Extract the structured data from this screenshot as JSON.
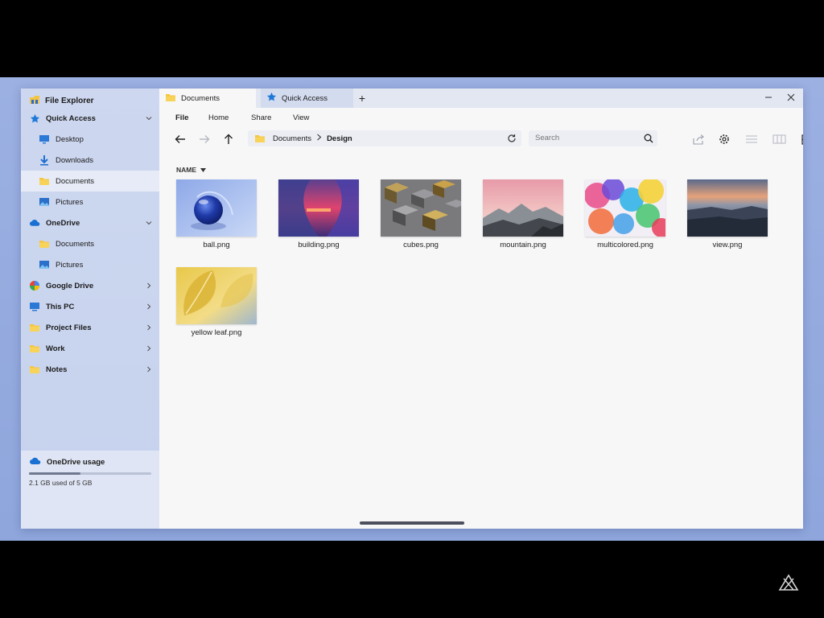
{
  "sidebar": {
    "title": "File Explorer",
    "items": [
      {
        "label": "Quick Access",
        "icon": "star-icon",
        "level": 1,
        "chevron": "down"
      },
      {
        "label": "Desktop",
        "icon": "desktop-icon",
        "level": 2
      },
      {
        "label": "Downloads",
        "icon": "download-icon",
        "level": 2
      },
      {
        "label": "Documents",
        "icon": "folder-icon",
        "level": 2,
        "active": true
      },
      {
        "label": "Pictures",
        "icon": "pictures-icon",
        "level": 2
      },
      {
        "label": "OneDrive",
        "icon": "cloud-icon",
        "level": 1,
        "chevron": "down"
      },
      {
        "label": "Documents",
        "icon": "folder-icon",
        "level": 2
      },
      {
        "label": "Pictures",
        "icon": "pictures-icon",
        "level": 2
      },
      {
        "label": "Google Drive",
        "icon": "google-drive-icon",
        "level": 1,
        "chevron": "right"
      },
      {
        "label": "This PC",
        "icon": "pc-icon",
        "level": 1,
        "chevron": "right"
      },
      {
        "label": "Project Files",
        "icon": "folder-icon",
        "level": 1,
        "chevron": "right"
      },
      {
        "label": "Work",
        "icon": "folder-icon",
        "level": 1,
        "chevron": "right"
      },
      {
        "label": "Notes",
        "icon": "folder-icon",
        "level": 1,
        "chevron": "right"
      }
    ],
    "usage": {
      "title": "OneDrive usage",
      "text": "2.1 GB used of 5 GB",
      "used_fraction": 0.42
    }
  },
  "tabs": [
    {
      "label": "Documents",
      "icon": "folder-icon",
      "active": true
    },
    {
      "label": "Quick Access",
      "icon": "star-icon",
      "active": false
    }
  ],
  "menu": {
    "file": "File",
    "home": "Home",
    "share": "Share",
    "view": "View"
  },
  "breadcrumb": {
    "parent": "Documents",
    "current": "Design"
  },
  "search": {
    "placeholder": "Search"
  },
  "column_header": "NAME",
  "files": [
    {
      "name": "ball.png"
    },
    {
      "name": "building.png"
    },
    {
      "name": "cubes.png"
    },
    {
      "name": "mountain.png"
    },
    {
      "name": "multicolored.png"
    },
    {
      "name": "view.png"
    },
    {
      "name": "yellow leaf.png"
    }
  ],
  "colors": {
    "accent": "#1a73e8",
    "folder": "#f4c542",
    "sidebar": "#cdd7ef",
    "background": "#9cb0e2"
  }
}
